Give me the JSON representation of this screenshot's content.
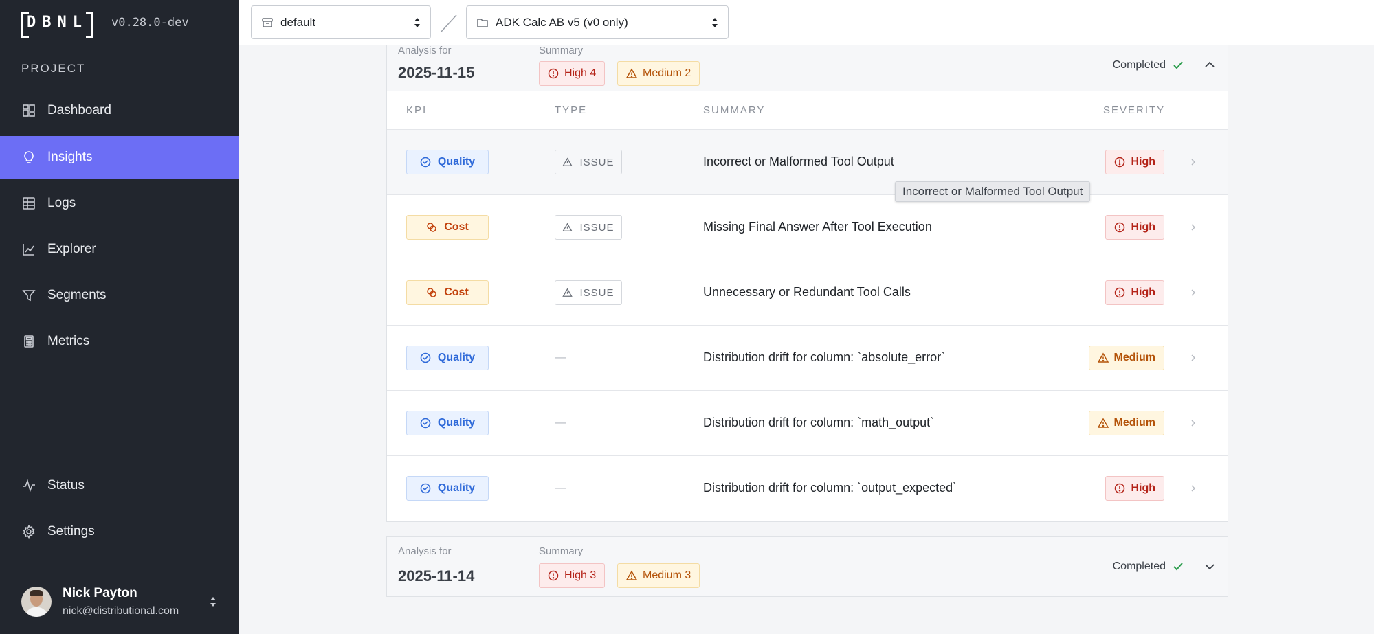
{
  "app": {
    "logo_text": "DBNL",
    "version": "v0.28.0-dev",
    "section_label": "PROJECT"
  },
  "sidebar": {
    "items": [
      {
        "label": "Dashboard",
        "icon": "dashboard-icon"
      },
      {
        "label": "Insights",
        "icon": "lightbulb-icon",
        "active": true
      },
      {
        "label": "Logs",
        "icon": "table-icon"
      },
      {
        "label": "Explorer",
        "icon": "line-chart-icon"
      },
      {
        "label": "Segments",
        "icon": "filter-icon"
      },
      {
        "label": "Metrics",
        "icon": "calculator-icon"
      }
    ],
    "bottom_items": [
      {
        "label": "Status",
        "icon": "activity-icon"
      },
      {
        "label": "Settings",
        "icon": "gear-icon"
      }
    ],
    "user": {
      "name": "Nick Payton",
      "email": "nick@distributional.com"
    }
  },
  "topbar": {
    "namespace_select": "default",
    "project_select": "ADK Calc AB v5 (v0 only)"
  },
  "analyses": [
    {
      "label": "Analysis for",
      "date": "2025-11-15",
      "summary_label": "Summary",
      "high": "High 4",
      "medium": "Medium 2",
      "status": "Completed",
      "expanded": true,
      "columns": [
        "KPI",
        "TYPE",
        "SUMMARY",
        "SEVERITY"
      ],
      "rows": [
        {
          "kpi": "Quality",
          "type": "ISSUE",
          "summary": "Incorrect or Malformed Tool Output",
          "severity": "High"
        },
        {
          "kpi": "Cost",
          "type": "ISSUE",
          "summary": "Missing Final Answer After Tool Execution",
          "severity": "High"
        },
        {
          "kpi": "Cost",
          "type": "ISSUE",
          "summary": "Unnecessary or Redundant Tool Calls",
          "severity": "High"
        },
        {
          "kpi": "Quality",
          "type": "—",
          "summary": "Distribution drift for column: `absolute_error`",
          "severity": "Medium"
        },
        {
          "kpi": "Quality",
          "type": "—",
          "summary": "Distribution drift for column: `math_output`",
          "severity": "Medium"
        },
        {
          "kpi": "Quality",
          "type": "—",
          "summary": "Distribution drift for column: `output_expected`",
          "severity": "High"
        }
      ]
    },
    {
      "label": "Analysis for",
      "date": "2025-11-14",
      "summary_label": "Summary",
      "high": "High 3",
      "medium": "Medium 3",
      "status": "Completed",
      "expanded": false
    }
  ],
  "tooltip": "Incorrect or Malformed Tool Output",
  "colors": {
    "sidebar_bg": "#22262e",
    "accent": "#6c6ef5",
    "high": "#b42318",
    "medium": "#b45309",
    "quality": "#2f6ad9",
    "completed": "#2e9e4f"
  }
}
